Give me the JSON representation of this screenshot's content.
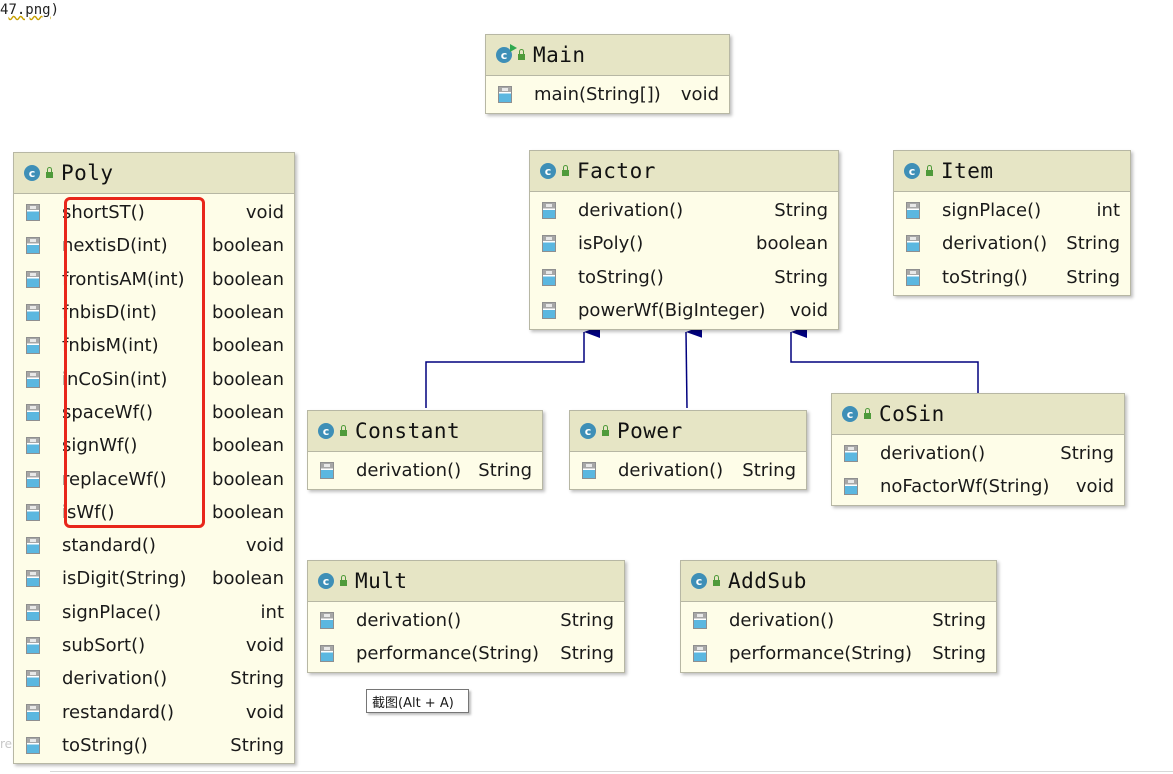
{
  "file_fragment": {
    "prefix": "4",
    "name": "7.png",
    "suffix": ")"
  },
  "edge_text": "re",
  "tooltip": "截图(Alt + A)",
  "classes": {
    "main": {
      "name": "Main",
      "methods": [
        {
          "name": "main(String[])",
          "type": "void"
        }
      ]
    },
    "poly": {
      "name": "Poly",
      "methods": [
        {
          "name": "shortST()",
          "type": "void"
        },
        {
          "name": "nextisD(int)",
          "type": "boolean"
        },
        {
          "name": "frontisAM(int)",
          "type": "boolean"
        },
        {
          "name": "fnbisD(int)",
          "type": "boolean"
        },
        {
          "name": "fnbisM(int)",
          "type": "boolean"
        },
        {
          "name": "inCoSin(int)",
          "type": "boolean"
        },
        {
          "name": "spaceWf()",
          "type": "boolean"
        },
        {
          "name": "signWf()",
          "type": "boolean"
        },
        {
          "name": "replaceWf()",
          "type": "boolean"
        },
        {
          "name": "isWf()",
          "type": "boolean"
        },
        {
          "name": "standard()",
          "type": "void"
        },
        {
          "name": "isDigit(String)",
          "type": "boolean"
        },
        {
          "name": "signPlace()",
          "type": "int"
        },
        {
          "name": "subSort()",
          "type": "void"
        },
        {
          "name": "derivation()",
          "type": "String"
        },
        {
          "name": "restandard()",
          "type": "void"
        },
        {
          "name": "toString()",
          "type": "String"
        }
      ]
    },
    "factor": {
      "name": "Factor",
      "methods": [
        {
          "name": "derivation()",
          "type": "String"
        },
        {
          "name": "isPoly()",
          "type": "boolean"
        },
        {
          "name": "toString()",
          "type": "String"
        },
        {
          "name": "powerWf(BigInteger)",
          "type": "void"
        }
      ]
    },
    "item": {
      "name": "Item",
      "methods": [
        {
          "name": "signPlace()",
          "type": "int"
        },
        {
          "name": "derivation()",
          "type": "String"
        },
        {
          "name": "toString()",
          "type": "String"
        }
      ]
    },
    "constant": {
      "name": "Constant",
      "methods": [
        {
          "name": "derivation()",
          "type": "String"
        }
      ]
    },
    "power": {
      "name": "Power",
      "methods": [
        {
          "name": "derivation()",
          "type": "String"
        }
      ]
    },
    "cosin": {
      "name": "CoSin",
      "methods": [
        {
          "name": "derivation()",
          "type": "String"
        },
        {
          "name": "noFactorWf(String)",
          "type": "void"
        }
      ]
    },
    "mult": {
      "name": "Mult",
      "methods": [
        {
          "name": "derivation()",
          "type": "String"
        },
        {
          "name": "performance(String)",
          "type": "String"
        }
      ]
    },
    "addsub": {
      "name": "AddSub",
      "methods": [
        {
          "name": "derivation()",
          "type": "String"
        },
        {
          "name": "performance(String)",
          "type": "String"
        }
      ]
    }
  },
  "colors": {
    "class_body": "#fefde8",
    "class_header": "#e6e5c5",
    "class_icon": "#3e8fb7",
    "lock_icon": "#4e9a3a",
    "arrow": "#00007f",
    "highlight_box": "#e8261b"
  },
  "icons": {
    "class": "class-c-icon",
    "visibility": "public-lock-icon",
    "method": "method-icon",
    "runnable": "run-icon"
  }
}
